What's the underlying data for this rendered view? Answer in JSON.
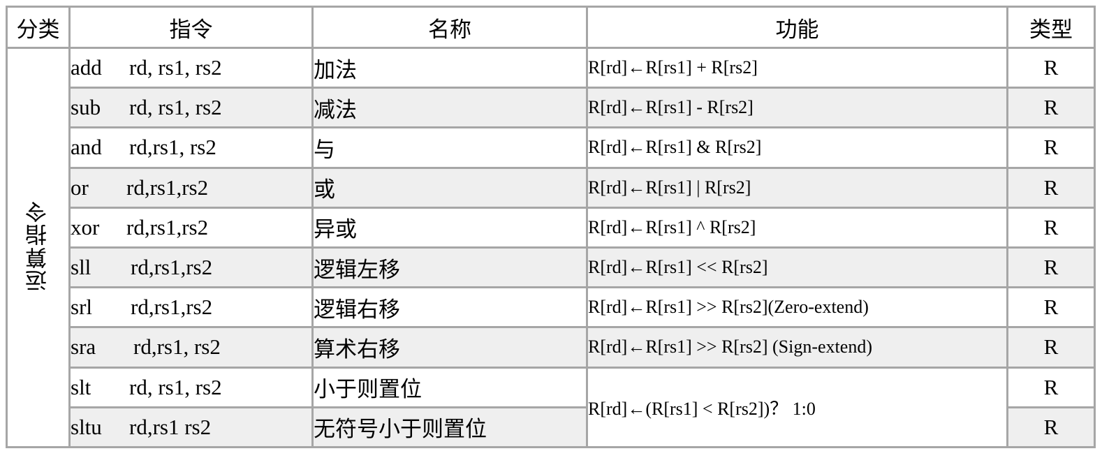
{
  "headers": {
    "category": "分类",
    "instruction": "指令",
    "name": "名称",
    "function": "功能",
    "type": "类型"
  },
  "category_label": "运算指令",
  "rows": [
    {
      "mnemonic": "add",
      "operands": "rd, rs1, rs2",
      "name": "加法",
      "function": "R[rd]←R[rs1] + R[rs2]",
      "type": "R"
    },
    {
      "mnemonic": "sub",
      "operands": "rd, rs1, rs2",
      "name": "减法",
      "function": "R[rd]←R[rs1] - R[rs2]",
      "type": "R"
    },
    {
      "mnemonic": "and",
      "operands": "rd,rs1, rs2",
      "name": "与",
      "function": "R[rd]←R[rs1] & R[rs2]",
      "type": "R"
    },
    {
      "mnemonic": "or",
      "operands": "rd,rs1,rs2",
      "name": "或",
      "function": "R[rd]←R[rs1] | R[rs2]",
      "type": "R"
    },
    {
      "mnemonic": "xor",
      "operands": "rd,rs1,rs2",
      "name": "异或",
      "function": "R[rd]←R[rs1] ^ R[rs2]",
      "type": "R"
    },
    {
      "mnemonic": "sll",
      "operands": "rd,rs1,rs2",
      "name": "逻辑左移",
      "function": "R[rd]←R[rs1] << R[rs2]",
      "type": "R"
    },
    {
      "mnemonic": "srl",
      "operands": "rd,rs1,rs2",
      "name": "逻辑右移",
      "function": "R[rd]←R[rs1] >> R[rs2](Zero-extend)",
      "type": "R"
    },
    {
      "mnemonic": "sra",
      "operands": "rd,rs1, rs2",
      "name": "算术右移",
      "function": "R[rd]←R[rs1] >> R[rs2] (Sign-extend)",
      "type": "R"
    },
    {
      "mnemonic": "slt",
      "operands": "rd, rs1, rs2",
      "name": "小于则置位",
      "function": "",
      "type": "R"
    },
    {
      "mnemonic": "sltu",
      "operands": "rd,rs1 rs2",
      "name": "无符号小于则置位",
      "function": "",
      "type": "R"
    }
  ],
  "merged_function": "R[rd]←(R[rs1] < R[rs2])？ 1:0",
  "colors": {
    "border": "#a6a6a6",
    "shaded_row": "#efefef"
  }
}
